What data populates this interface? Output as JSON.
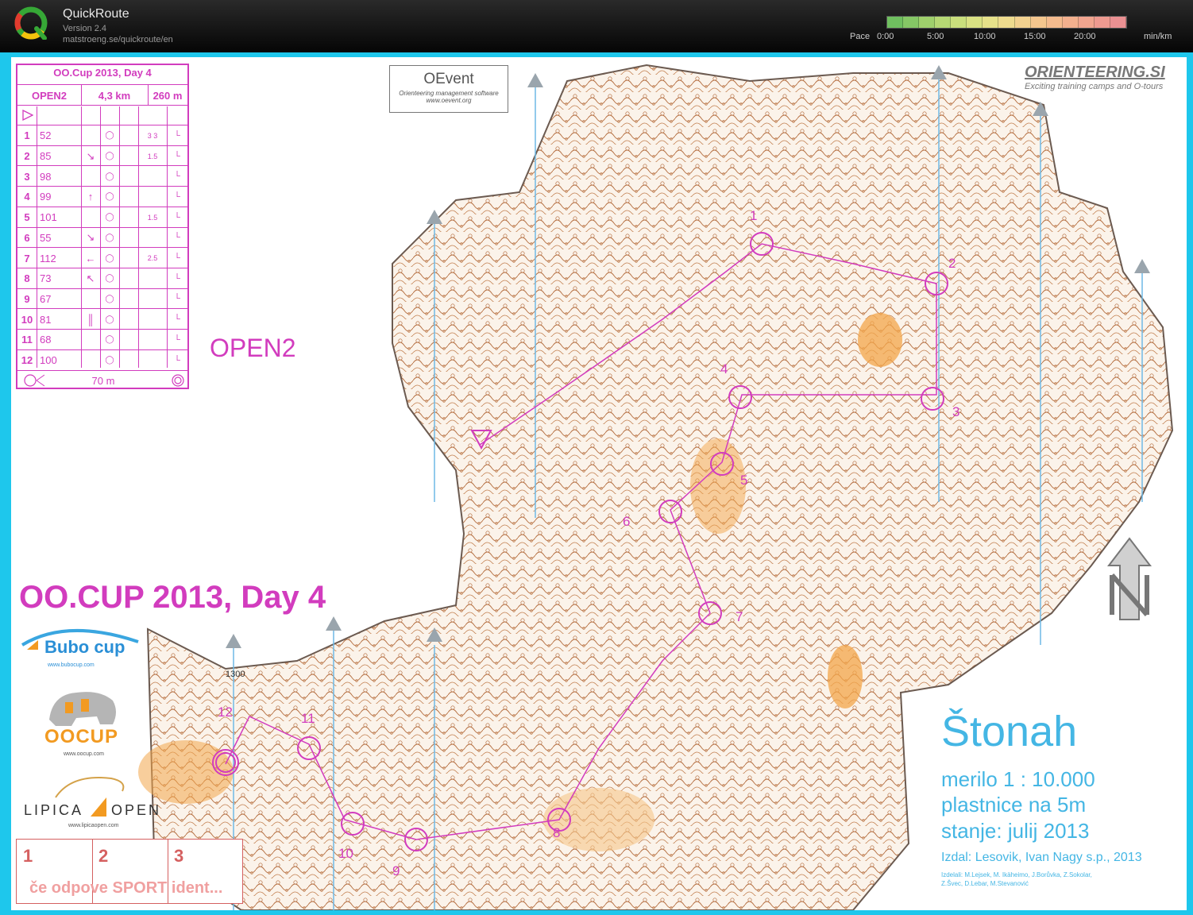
{
  "app": {
    "title": "QuickRoute",
    "version": "Version 2.4",
    "url": "matstroeng.se/quickroute/en"
  },
  "pace_scale": {
    "label": "Pace",
    "ticks": [
      "0:00",
      "5:00",
      "10:00",
      "15:00",
      "20:00"
    ],
    "unit": "min/km",
    "colors": [
      "#6fbf5f",
      "#85c765",
      "#9fd06c",
      "#b6d874",
      "#c9de7c",
      "#d9e183",
      "#e6e18a",
      "#eedb8e",
      "#f2d18f",
      "#f4c68e",
      "#f4bb8e",
      "#f3b08e",
      "#f1a58f",
      "#ee9a90",
      "#ea9092"
    ]
  },
  "map": {
    "course_box": {
      "title": "OO.Cup 2013, Day 4",
      "class": "OPEN2",
      "distance": "4,3 km",
      "climb": "260 m",
      "controls": [
        {
          "num": "1",
          "code": "52",
          "size": "3\n3"
        },
        {
          "num": "2",
          "code": "85",
          "size": "1.5"
        },
        {
          "num": "3",
          "code": "98",
          "size": ""
        },
        {
          "num": "4",
          "code": "99",
          "size": ""
        },
        {
          "num": "5",
          "code": "101",
          "size": "1.5"
        },
        {
          "num": "6",
          "code": "55",
          "size": ""
        },
        {
          "num": "7",
          "code": "112",
          "size": "2.5"
        },
        {
          "num": "8",
          "code": "73",
          "size": ""
        },
        {
          "num": "9",
          "code": "67",
          "size": ""
        },
        {
          "num": "10",
          "code": "81",
          "size": ""
        },
        {
          "num": "11",
          "code": "68",
          "size": ""
        },
        {
          "num": "12",
          "code": "100",
          "size": ""
        }
      ],
      "finish_distance": "70 m"
    },
    "class_label": "OPEN2",
    "event_title": "OO.CUP 2013, Day 4",
    "oevent": {
      "name": "OEvent",
      "tagline": "Orienteering management software",
      "url": "www.oevent.org"
    },
    "brand": {
      "name": "ORIENTEERING.SI",
      "tagline": "Exciting training camps and O-tours"
    },
    "sponsors": {
      "bubo": "Bubo cup",
      "bubo_url": "www.bubocup.com",
      "oocup": "OOCUP",
      "oocup_url": "www.oocup.com",
      "lipica_left": "LIPICA",
      "lipica_right": "OPEN",
      "lipica_url": "www.lipicaopen.com"
    },
    "map_info": {
      "name": "Štonah",
      "scale": "merilo 1 : 10.000",
      "contours": "plastnice na 5m",
      "status": "stanje: julij 2013",
      "publisher": "Izdal: Lesovik, Ivan Nagy s.p., 2013",
      "credits_1": "Izdelali: M.Lejsek, M. Ikäheimo, J.Borůvka, Z.Sokolar,",
      "credits_2": "Z.Švec, D.Lebar, M.Stevanović"
    },
    "sportident": {
      "boxes": [
        "1",
        "2",
        "3"
      ],
      "note": "če odpove SPORT ident..."
    },
    "elevation_label": "1300",
    "control_numbers": [
      "1",
      "2",
      "3",
      "4",
      "5",
      "6",
      "7",
      "8",
      "9",
      "10",
      "11",
      "12"
    ]
  }
}
